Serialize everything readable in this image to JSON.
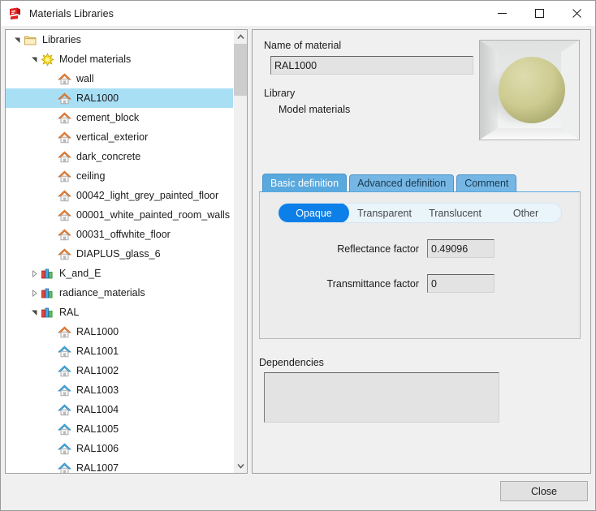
{
  "window": {
    "title": "Materials Libraries",
    "icon": "materials-app-icon",
    "controls": {
      "minimize": "minimize-icon",
      "maximize": "maximize-icon",
      "close": "close-icon"
    }
  },
  "tree": {
    "scrollbar": {
      "up_arrow": "chevron-up-icon",
      "down_arrow": "chevron-down-icon"
    },
    "items": [
      {
        "label": "Libraries",
        "indent": 0,
        "icon": "folder-icon",
        "twisty": "expanded",
        "selected": false
      },
      {
        "label": "Model materials",
        "indent": 1,
        "icon": "star-icon",
        "twisty": "expanded",
        "selected": false
      },
      {
        "label": "wall",
        "indent": 2,
        "icon": "house-orange-icon",
        "twisty": "none",
        "selected": false
      },
      {
        "label": "RAL1000",
        "indent": 2,
        "icon": "house-orange-icon",
        "twisty": "none",
        "selected": true
      },
      {
        "label": "cement_block",
        "indent": 2,
        "icon": "house-orange-icon",
        "twisty": "none",
        "selected": false
      },
      {
        "label": "vertical_exterior",
        "indent": 2,
        "icon": "house-orange-icon",
        "twisty": "none",
        "selected": false
      },
      {
        "label": "dark_concrete",
        "indent": 2,
        "icon": "house-orange-icon",
        "twisty": "none",
        "selected": false
      },
      {
        "label": "ceiling",
        "indent": 2,
        "icon": "house-orange-icon",
        "twisty": "none",
        "selected": false
      },
      {
        "label": "00042_light_grey_painted_floor",
        "indent": 2,
        "icon": "house-orange-icon",
        "twisty": "none",
        "selected": false
      },
      {
        "label": "00001_white_painted_room_walls",
        "indent": 2,
        "icon": "house-orange-icon",
        "twisty": "none",
        "selected": false
      },
      {
        "label": "00031_offwhite_floor",
        "indent": 2,
        "icon": "house-orange-icon",
        "twisty": "none",
        "selected": false
      },
      {
        "label": "DIAPLUS_glass_6",
        "indent": 2,
        "icon": "house-orange-icon",
        "twisty": "none",
        "selected": false
      },
      {
        "label": "K_and_E",
        "indent": 1,
        "icon": "library-icon",
        "twisty": "collapsed",
        "selected": false
      },
      {
        "label": "radiance_materials",
        "indent": 1,
        "icon": "library-icon",
        "twisty": "collapsed",
        "selected": false
      },
      {
        "label": "RAL",
        "indent": 1,
        "icon": "library-icon",
        "twisty": "expanded",
        "selected": false
      },
      {
        "label": "RAL1000",
        "indent": 2,
        "icon": "house-orange-icon",
        "twisty": "none",
        "selected": false
      },
      {
        "label": "RAL1001",
        "indent": 2,
        "icon": "house-blue-icon",
        "twisty": "none",
        "selected": false
      },
      {
        "label": "RAL1002",
        "indent": 2,
        "icon": "house-blue-icon",
        "twisty": "none",
        "selected": false
      },
      {
        "label": "RAL1003",
        "indent": 2,
        "icon": "house-blue-icon",
        "twisty": "none",
        "selected": false
      },
      {
        "label": "RAL1004",
        "indent": 2,
        "icon": "house-blue-icon",
        "twisty": "none",
        "selected": false
      },
      {
        "label": "RAL1005",
        "indent": 2,
        "icon": "house-blue-icon",
        "twisty": "none",
        "selected": false
      },
      {
        "label": "RAL1006",
        "indent": 2,
        "icon": "house-blue-icon",
        "twisty": "none",
        "selected": false
      },
      {
        "label": "RAL1007",
        "indent": 2,
        "icon": "house-blue-icon",
        "twisty": "none",
        "selected": false
      }
    ]
  },
  "details": {
    "name_label": "Name of material",
    "name_value": "RAL1000",
    "library_label": "Library",
    "library_value": "Model materials",
    "preview": {
      "name": "material-preview-sphere",
      "sphere_color": "#cfcd92",
      "background_color": "#ececec"
    },
    "tabs": [
      {
        "label": "Basic definition",
        "active": true
      },
      {
        "label": "Advanced definition",
        "active": false
      },
      {
        "label": "Comment",
        "active": false
      }
    ],
    "material_types": [
      {
        "label": "Opaque",
        "selected": true
      },
      {
        "label": "Transparent",
        "selected": false
      },
      {
        "label": "Translucent",
        "selected": false
      },
      {
        "label": "Other",
        "selected": false
      }
    ],
    "factors": [
      {
        "label": "Reflectance factor",
        "value": "0.49096"
      },
      {
        "label": "Transmittance factor",
        "value": "0"
      }
    ],
    "dependencies_label": "Dependencies",
    "dependencies_value": ""
  },
  "footer": {
    "close_label": "Close"
  },
  "colors": {
    "selection": "#a9dff5",
    "tab_active": "#5aa9de",
    "tab_inactive": "#76b6e4",
    "segment_on": "#0c7fe8",
    "field_bg": "#e3e3e3"
  }
}
